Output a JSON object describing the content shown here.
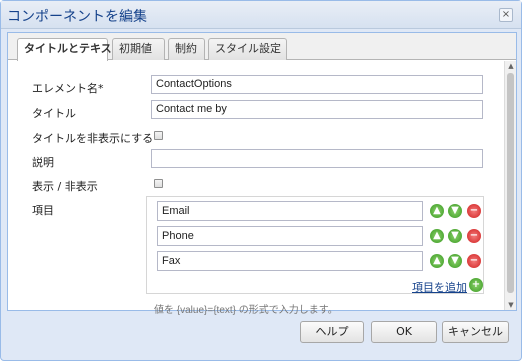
{
  "dialog": {
    "title": "コンポーネントを編集",
    "close_symbol": "×"
  },
  "tabs": [
    {
      "label": "タイトルとテキスト",
      "active": true
    },
    {
      "label": "初期値",
      "active": false
    },
    {
      "label": "制約",
      "active": false
    },
    {
      "label": "スタイル設定",
      "active": false
    }
  ],
  "form": {
    "element_name": {
      "label": "エレメント名*",
      "value": "ContactOptions"
    },
    "title": {
      "label": "タイトル",
      "value": "Contact me by"
    },
    "hide_title": {
      "label": "タイトルを非表示にする",
      "checked": false
    },
    "description": {
      "label": "説明",
      "value": ""
    },
    "show_hide": {
      "label": "表示 / 非表示",
      "checked": false
    },
    "items": {
      "label": "項目",
      "values": [
        "Email",
        "Phone",
        "Fax"
      ],
      "add_label": "項目を追加",
      "hint": "値を {value}={text} の形式で入力します。"
    }
  },
  "footer": {
    "help_label": "ヘルプ",
    "ok_label": "OK",
    "cancel_label": "キャンセル"
  },
  "icons": {
    "up": "move-up-icon",
    "down": "move-down-icon",
    "remove": "remove-icon",
    "add": "add-icon",
    "close": "close-icon"
  },
  "colors": {
    "title_text": "#15428b",
    "frame_border": "#99bbe8",
    "up_down_green": "#3a9a22",
    "remove_red": "#d02020"
  }
}
